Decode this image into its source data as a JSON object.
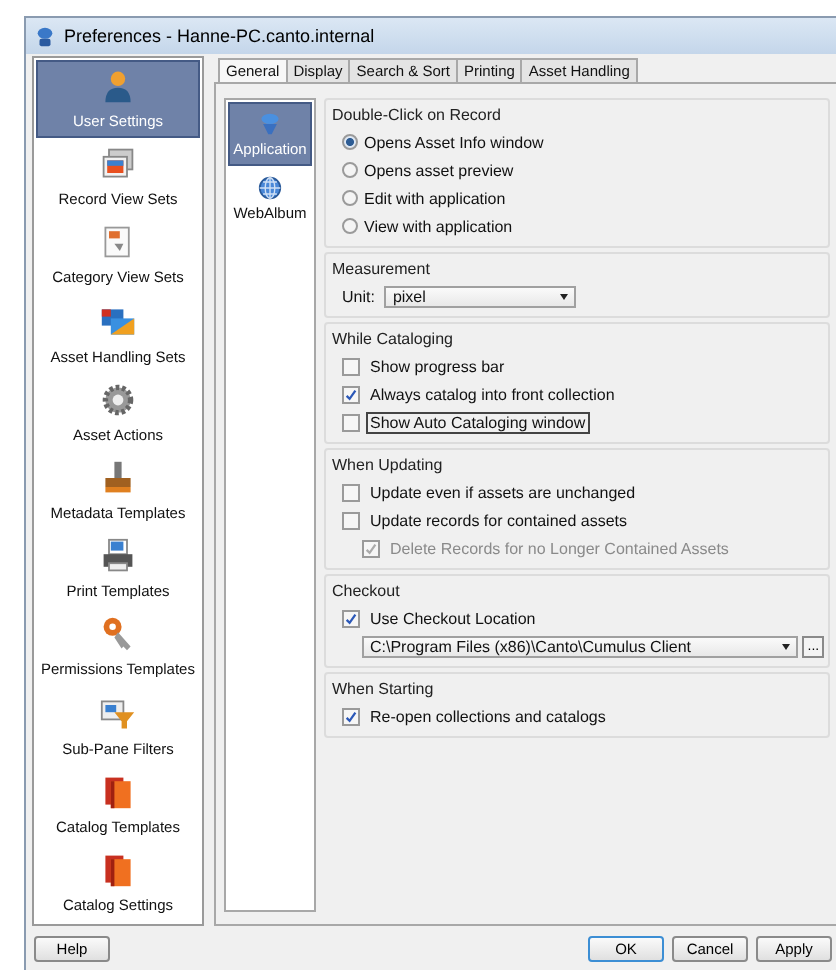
{
  "window": {
    "title": "Preferences - Hanne-PC.canto.internal"
  },
  "sidebar": {
    "items": [
      {
        "label": "User Settings",
        "selected": true
      },
      {
        "label": "Record View Sets",
        "selected": false
      },
      {
        "label": "Category View Sets",
        "selected": false
      },
      {
        "label": "Asset Handling Sets",
        "selected": false
      },
      {
        "label": "Asset Actions",
        "selected": false
      },
      {
        "label": "Metadata Templates",
        "selected": false
      },
      {
        "label": "Print Templates",
        "selected": false
      },
      {
        "label": "Permissions Templates",
        "selected": false
      },
      {
        "label": "Sub-Pane Filters",
        "selected": false
      },
      {
        "label": "Catalog Templates",
        "selected": false
      },
      {
        "label": "Catalog Settings",
        "selected": false
      }
    ]
  },
  "tabs": [
    {
      "label": "General",
      "selected": true
    },
    {
      "label": "Display",
      "selected": false
    },
    {
      "label": "Search & Sort",
      "selected": false
    },
    {
      "label": "Printing",
      "selected": false
    },
    {
      "label": "Asset Handling",
      "selected": false
    }
  ],
  "subnav": [
    {
      "label": "Application",
      "selected": true
    },
    {
      "label": "WebAlbum",
      "selected": false
    }
  ],
  "sections": [
    {
      "title": "Double-Click on Record",
      "items": [
        {
          "kind": "radio",
          "label": "Opens Asset Info window",
          "selected": true
        },
        {
          "kind": "radio",
          "label": "Opens asset preview",
          "selected": false
        },
        {
          "kind": "radio",
          "label": "Edit with application",
          "selected": false
        },
        {
          "kind": "radio",
          "label": "View with application",
          "selected": false
        }
      ]
    },
    {
      "title": "Measurement",
      "items": [
        {
          "kind": "select",
          "label": "Unit:",
          "value": "pixel"
        }
      ]
    },
    {
      "title": "While Cataloging",
      "items": [
        {
          "kind": "checkbox",
          "label": "Show progress bar",
          "checked": false,
          "focused": false
        },
        {
          "kind": "checkbox",
          "label": "Always catalog into front collection",
          "checked": true,
          "focused": false
        },
        {
          "kind": "checkbox",
          "label": "Show Auto Cataloging window",
          "checked": false,
          "focused": true
        }
      ]
    },
    {
      "title": "When Updating",
      "items": [
        {
          "kind": "checkbox",
          "label": "Update even if assets are unchanged",
          "checked": false,
          "focused": false
        },
        {
          "kind": "checkbox",
          "label": "Update records for contained assets",
          "checked": false,
          "focused": false,
          "children": [
            {
              "kind": "checkbox",
              "label": "Delete Records for no Longer Contained Assets",
              "checked": true,
              "disabled": true,
              "focused": false
            }
          ]
        }
      ]
    },
    {
      "title": "Checkout",
      "items": [
        {
          "kind": "checkbox",
          "label": "Use Checkout Location",
          "checked": true,
          "focused": false
        },
        {
          "kind": "path",
          "value": "C:\\Program Files (x86)\\Canto\\Cumulus Client",
          "browse": "..."
        }
      ]
    },
    {
      "title": "When Starting",
      "items": [
        {
          "kind": "checkbox",
          "label": "Re-open collections and catalogs",
          "checked": true,
          "focused": false
        }
      ]
    }
  ],
  "buttons": {
    "help": "Help",
    "actions": [
      "OK",
      "Cancel",
      "Apply"
    ]
  }
}
